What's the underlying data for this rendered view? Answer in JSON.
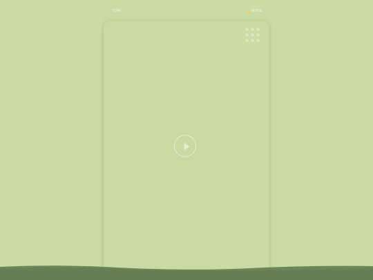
{
  "header": {
    "left_text": "7594",
    "right_text": "MUTE"
  },
  "icons": {
    "play": "play-icon",
    "grid_menu": "grid-menu-icon",
    "toggle": "toggle-indicator"
  },
  "colors": {
    "background": "#c9dca3",
    "ground": "#6c8659",
    "accent": "#e9d67a"
  }
}
